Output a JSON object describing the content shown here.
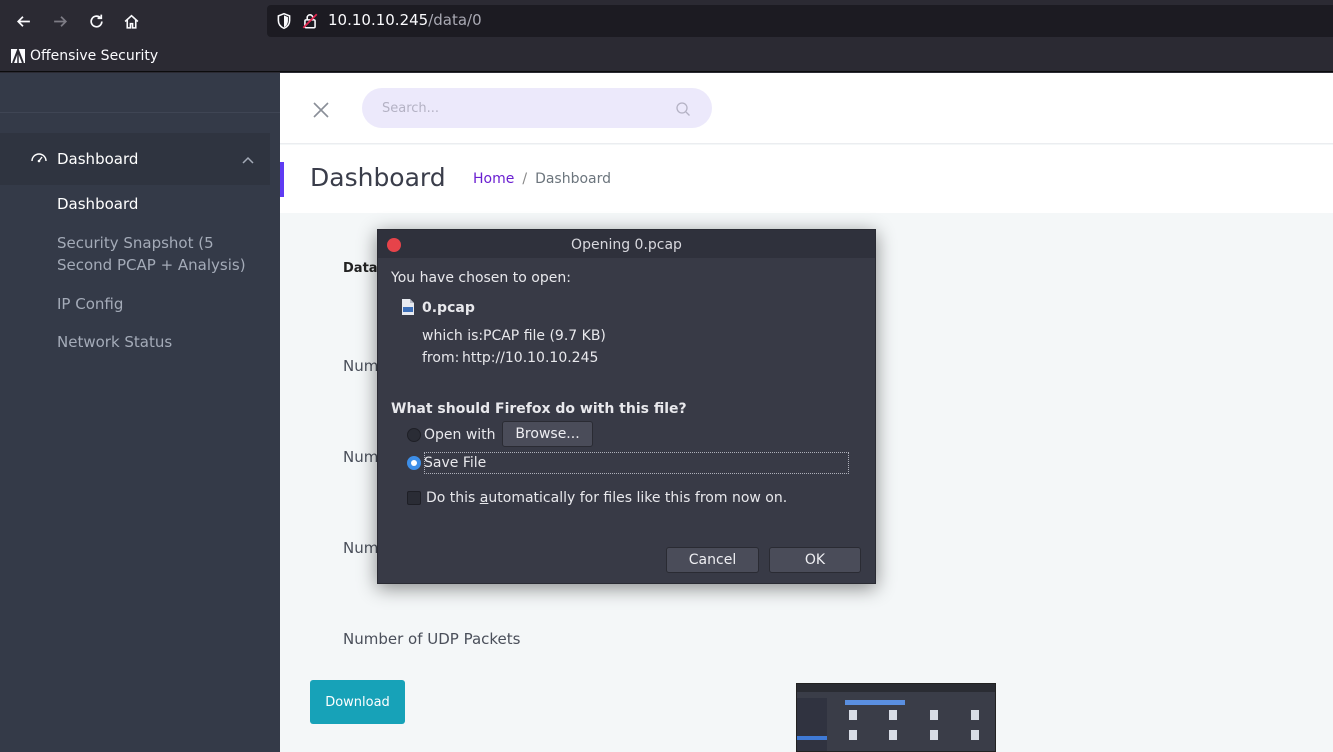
{
  "browser": {
    "url_host": "10.10.10.245",
    "url_path": "/data/0",
    "bookmark": "Offensive Security"
  },
  "search": {
    "placeholder": "Search..."
  },
  "sidebar": {
    "group_label": "Dashboard",
    "items": [
      {
        "label": "Dashboard"
      },
      {
        "label": "Security Snapshot (5 Second PCAP + Analysis)"
      },
      {
        "label": "IP Config"
      },
      {
        "label": "Network Status"
      }
    ]
  },
  "header": {
    "title": "Dashboard",
    "breadcrumb_home": "Home",
    "breadcrumb_sep": "/",
    "breadcrumb_current": "Dashboard"
  },
  "main": {
    "data_label": "Data",
    "num_label_1": "Num",
    "num_label_2": "Num",
    "num_label_3": "Num",
    "udp_label": "Number of UDP Packets",
    "download_label": "Download"
  },
  "dialog": {
    "title": "Opening 0.pcap",
    "intro": "You have chosen to open:",
    "filename": "0.pcap",
    "which_is_label": "which is:",
    "which_is_value": "PCAP file (9.7 KB)",
    "from_label": "from:",
    "from_value": "http://10.10.10.245",
    "question": "What should Firefox do with this file?",
    "open_with": "Open with",
    "browse": "Browse...",
    "save_file": "Save File",
    "auto_pre": "Do this ",
    "auto_u": "a",
    "auto_post": "utomatically for files like this from now on.",
    "cancel": "Cancel",
    "ok": "OK",
    "selected_option": "Save File"
  },
  "colors": {
    "accent": "#5f3bf3",
    "download_button": "#17a2b8",
    "breadcrumb_link": "#6a1fd1",
    "radio_selected": "#3d8ee8"
  }
}
